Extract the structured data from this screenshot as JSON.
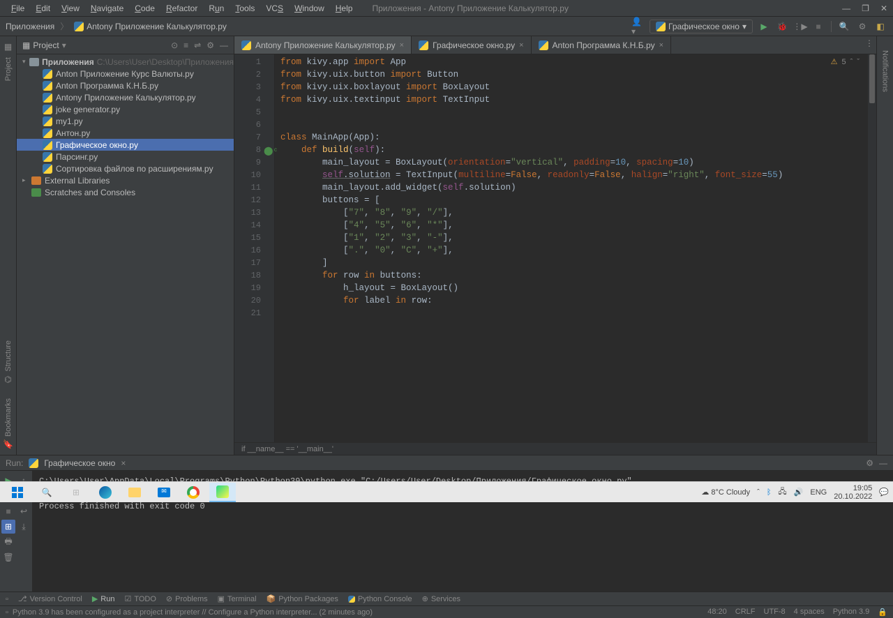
{
  "window": {
    "title": "Приложения - Antony Приложение Калькулятор.py",
    "minimize": "—",
    "maximize": "❐",
    "close": "✕"
  },
  "menu": [
    "File",
    "Edit",
    "View",
    "Navigate",
    "Code",
    "Refactor",
    "Run",
    "Tools",
    "VCS",
    "Window",
    "Help"
  ],
  "breadcrumb": {
    "root": "Приложения",
    "file": "Antony Приложение Калькулятор.py"
  },
  "run_config": "Графическое окно",
  "project_header": "Project",
  "project_root": {
    "name": "Приложения",
    "path": "C:\\Users\\User\\Desktop\\Приложения"
  },
  "project_files": [
    "Anton Приложение Курс Валюты.py",
    "Anton Программа К.Н.Б.py",
    "Antony Приложение Калькулятор.py",
    "joke generator.py",
    "my1.py",
    "Антон.py",
    "Графическое окно.py",
    "Парсинг.py",
    "Сортировка файлов по расширениям.py"
  ],
  "project_selected_index": 6,
  "project_extra": [
    "External Libraries",
    "Scratches and Consoles"
  ],
  "tabs": [
    {
      "label": "Antony Приложение Калькулятор.py",
      "active": true
    },
    {
      "label": "Графическое окно.py",
      "active": false
    },
    {
      "label": "Anton Программа К.Н.Б.py",
      "active": false
    }
  ],
  "warnings_count": "5",
  "breadcrumb_editor": "if __name__ == '__main__'",
  "code_lines": [
    {
      "n": 1,
      "html": "<span class='kw'>from</span> kivy.app <span class='kw'>import</span> App"
    },
    {
      "n": 2,
      "html": "<span class='kw'>from</span> kivy.uix.button <span class='kw'>import</span> Button"
    },
    {
      "n": 3,
      "html": "<span class='kw'>from</span> kivy.uix.boxlayout <span class='kw'>import</span> BoxLayout"
    },
    {
      "n": 4,
      "html": "<span class='kw'>from</span> kivy.uix.textinput <span class='kw'>import</span> TextInput"
    },
    {
      "n": 5,
      "html": ""
    },
    {
      "n": 6,
      "html": ""
    },
    {
      "n": 7,
      "html": "<span class='kw'>class </span><span class='cls'>MainApp</span>(App):"
    },
    {
      "n": 8,
      "html": "    <span class='kw'>def </span><span class='fn'>build</span>(<span class='self'>self</span>):",
      "mark": true
    },
    {
      "n": 9,
      "html": "        main_layout = BoxLayout(<span class='param'>orientation</span>=<span class='str'>\"vertical\"</span>, <span class='param'>padding</span>=<span class='num'>10</span>, <span class='param'>spacing</span>=<span class='num'>10</span>)"
    },
    {
      "n": 10,
      "html": "        <span class='self underline'>self</span><span class='underline'>.solution</span> = TextInput(<span class='param'>multiline</span>=<span class='kw'>False</span>, <span class='param'>readonly</span>=<span class='kw'>False</span>, <span class='param'>halign</span>=<span class='str'>\"right\"</span>, <span class='param'>font_size</span>=<span class='num'>55</span>)"
    },
    {
      "n": 11,
      "html": "        main_layout.add_widget(<span class='self'>self</span>.solution)"
    },
    {
      "n": 12,
      "html": "        buttons = ["
    },
    {
      "n": 13,
      "html": "            [<span class='str'>\"7\"</span>, <span class='str'>\"8\"</span>, <span class='str'>\"9\"</span>, <span class='str'>\"/\"</span>],"
    },
    {
      "n": 14,
      "html": "            [<span class='str'>\"4\"</span>, <span class='str'>\"5\"</span>, <span class='str'>\"6\"</span>, <span class='str'>\"*\"</span>],"
    },
    {
      "n": 15,
      "html": "            [<span class='str'>\"1\"</span>, <span class='str'>\"2\"</span>, <span class='str'>\"3\"</span>, <span class='str'>\"-\"</span>],"
    },
    {
      "n": 16,
      "html": "            [<span class='str'>\".\"</span>, <span class='str'>\"0\"</span>, <span class='str'>\"C\"</span>, <span class='str'>\"+\"</span>],"
    },
    {
      "n": 17,
      "html": "        ]"
    },
    {
      "n": 18,
      "html": "        <span class='kw'>for</span> row <span class='kw'>in</span> buttons:"
    },
    {
      "n": 19,
      "html": "            h_layout = BoxLayout()"
    },
    {
      "n": 20,
      "html": "            <span class='kw'>for</span> label <span class='kw'>in</span> row:"
    },
    {
      "n": 21,
      "html": "<span class='com'>                </span>"
    }
  ],
  "run": {
    "tab_title": "Графическое окно",
    "output_line1": "C:\\Users\\User\\AppData\\Local\\Programs\\Python\\Python39\\python.exe \"C:/Users/User/Desktop/Приложения/Графическое окно.py\"",
    "output_line2": "Process finished with exit code 0"
  },
  "bottom_tabs": [
    "Version Control",
    "Run",
    "TODO",
    "Problems",
    "Terminal",
    "Python Packages",
    "Python Console",
    "Services"
  ],
  "status": {
    "msg": "Python 3.9 has been configured as a project interpreter // Configure a Python interpreter... (2 minutes ago)",
    "pos": "48:20",
    "eol": "CRLF",
    "enc": "UTF-8",
    "indent": "4 spaces",
    "interpreter": "Python 3.9"
  },
  "sidebar_left": {
    "project": "Project",
    "structure": "Structure",
    "bookmarks": "Bookmarks"
  },
  "sidebar_right": {
    "notifications": "Notifications"
  },
  "taskbar": {
    "weather": "8°C  Cloudy",
    "lang": "ENG",
    "time": "19:05",
    "date": "20.10.2022"
  }
}
